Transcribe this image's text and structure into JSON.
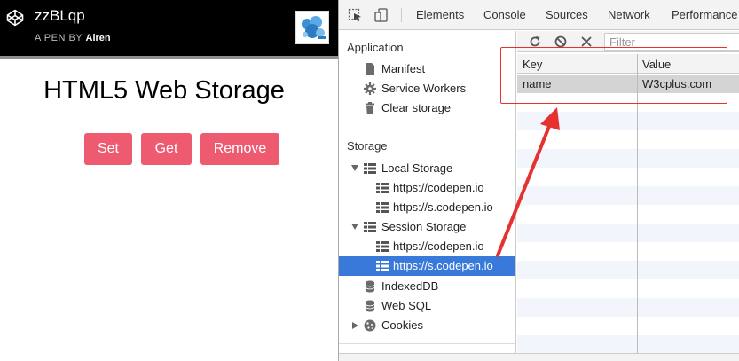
{
  "pen": {
    "title": "zzBLqp",
    "by_prefix": "A PEN BY",
    "author": "Airen"
  },
  "page": {
    "heading": "HTML5 Web Storage",
    "buttons": {
      "set": "Set",
      "get": "Get",
      "remove": "Remove"
    },
    "accent": "#ee5a70"
  },
  "devtools": {
    "tabs": [
      "Elements",
      "Console",
      "Sources",
      "Network",
      "Performance"
    ],
    "sidebar": {
      "application_title": "Application",
      "application_items": [
        "Manifest",
        "Service Workers",
        "Clear storage"
      ],
      "storage_title": "Storage",
      "local_storage": {
        "label": "Local Storage",
        "children": [
          "https://codepen.io",
          "https://s.codepen.io"
        ]
      },
      "session_storage": {
        "label": "Session Storage",
        "children": [
          "https://codepen.io",
          "https://s.codepen.io"
        ]
      },
      "other_items": [
        "IndexedDB",
        "Web SQL",
        "Cookies"
      ],
      "selected_color": "#3879d9"
    },
    "table": {
      "filter_placeholder": "Filter",
      "columns": {
        "key": "Key",
        "value": "Value"
      },
      "rows": [
        {
          "key": "name",
          "value": "W3cplus.com"
        }
      ]
    }
  },
  "annotation": {
    "color": "#e5322f"
  }
}
